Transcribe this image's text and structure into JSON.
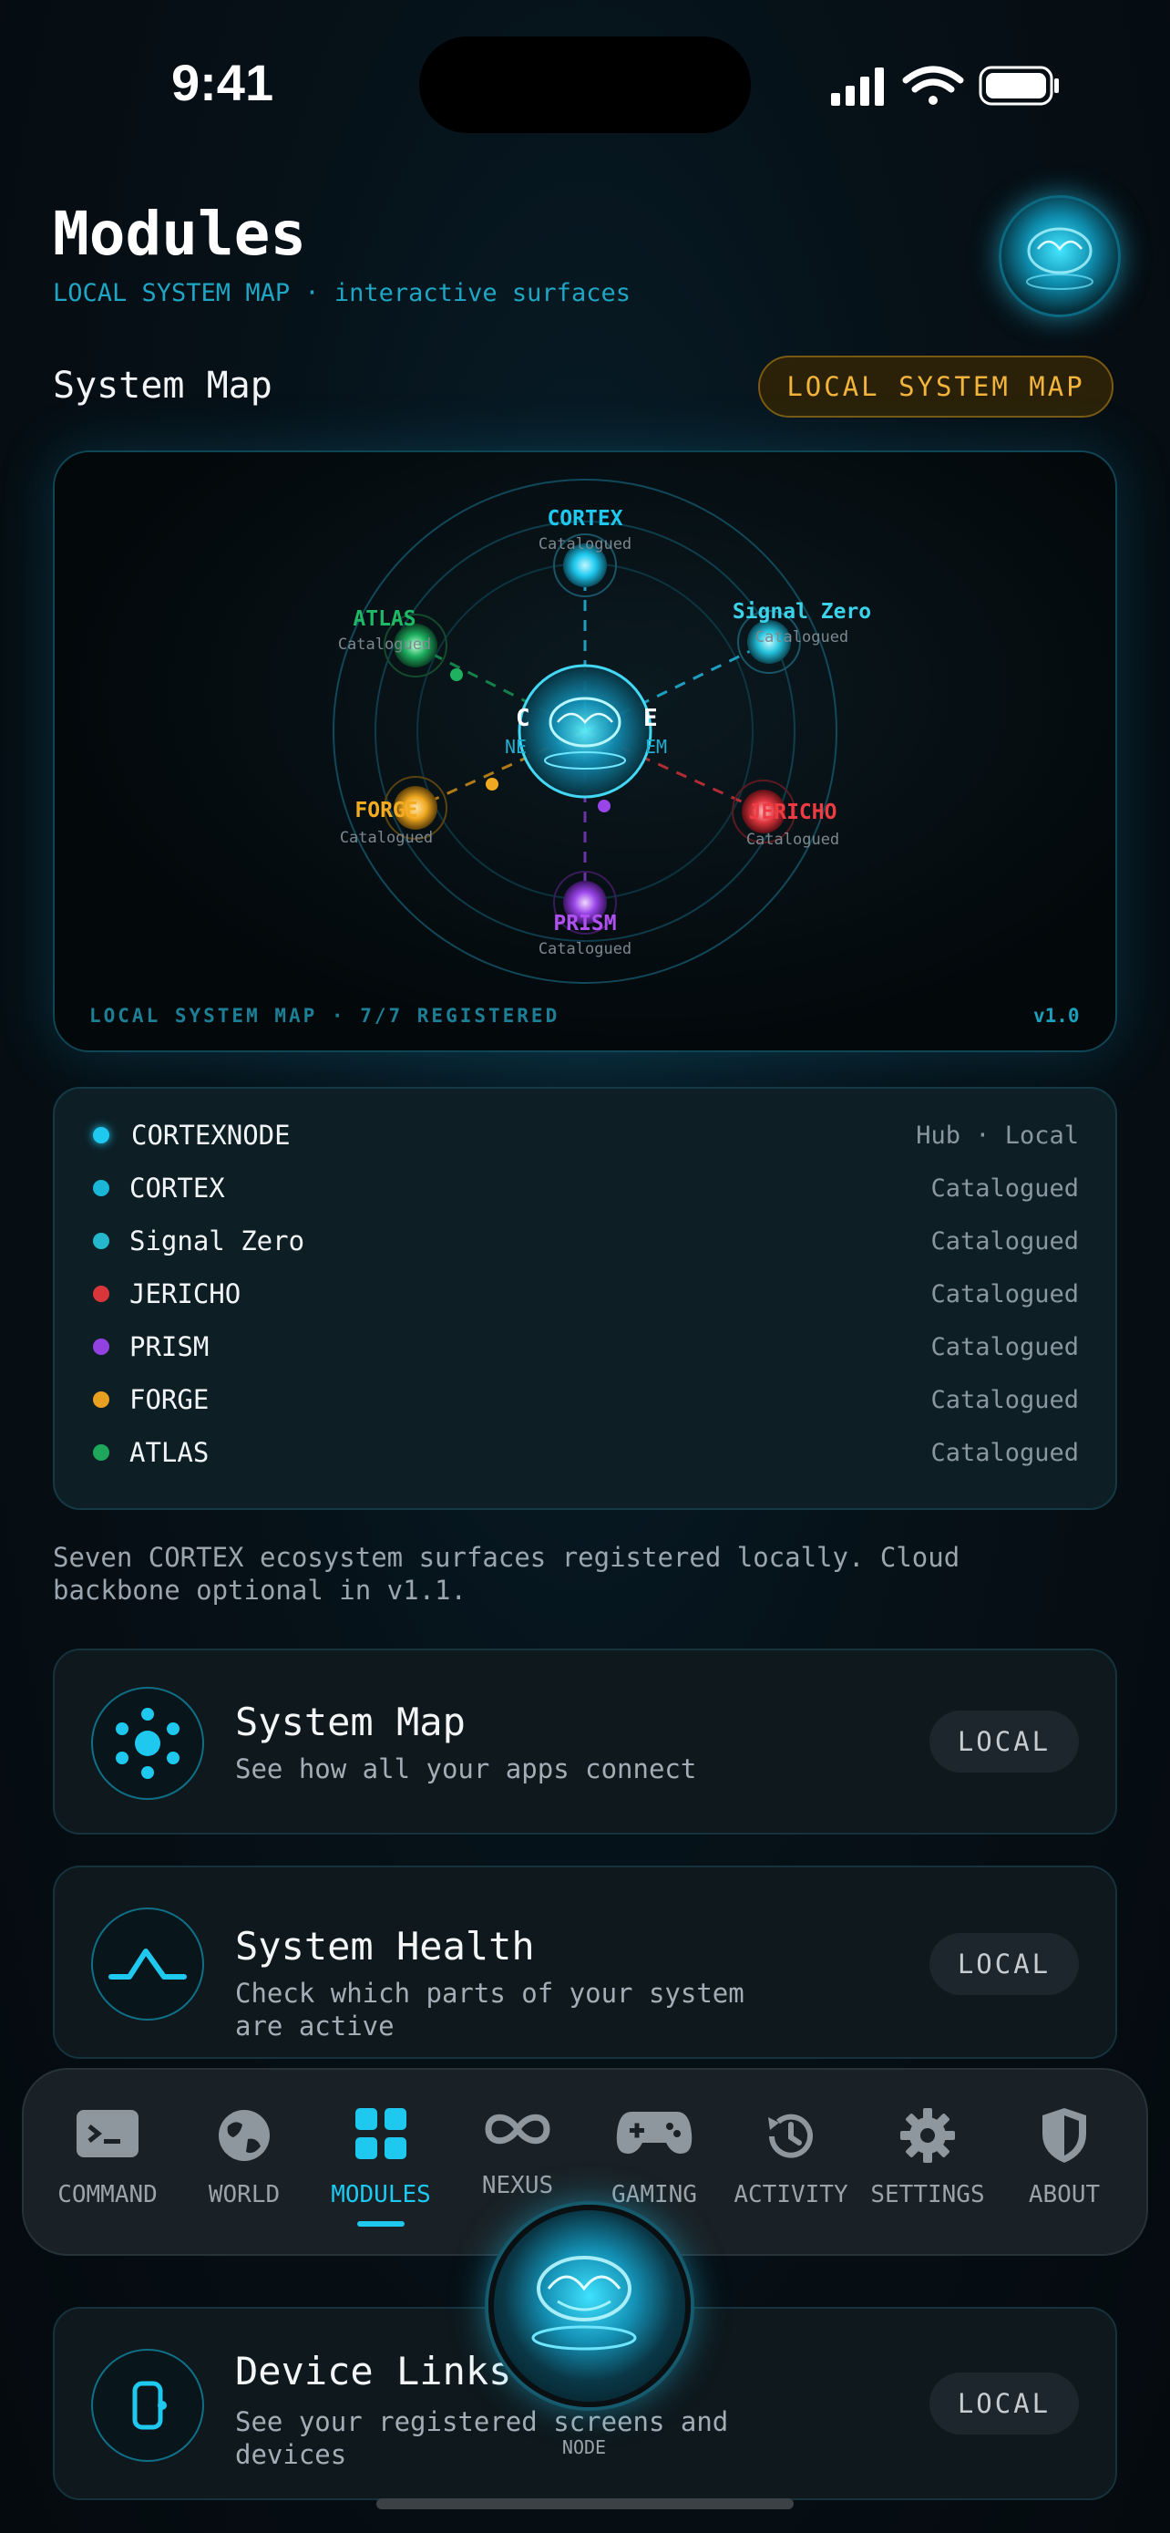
{
  "status_bar": {
    "time": "9:41"
  },
  "header": {
    "title": "Modules",
    "subtitle": "LOCAL SYSTEM MAP · interactive surfaces",
    "avatar_icon": "brain-hologram-icon"
  },
  "section": {
    "title": "System Map",
    "badge": "LOCAL SYSTEM MAP"
  },
  "map": {
    "hub": {
      "name_left": "C",
      "name_right": "E",
      "sub_left": "NE",
      "sub_right": "EM"
    },
    "nodes": [
      {
        "name": "CORTEX",
        "status": "Catalogued",
        "color": "#1ec8ee"
      },
      {
        "name": "Signal Zero",
        "status": "Catalogued",
        "color": "#25c2dc"
      },
      {
        "name": "JERICHO",
        "status": "Catalogued",
        "color": "#e0373f"
      },
      {
        "name": "PRISM",
        "status": "Catalogued",
        "color": "#9a45e8"
      },
      {
        "name": "FORGE",
        "status": "Catalogued",
        "color": "#f0a820"
      },
      {
        "name": "ATLAS",
        "status": "Catalogued",
        "color": "#1fb060"
      }
    ],
    "footer_left": "LOCAL SYSTEM MAP · 7/7 REGISTERED",
    "footer_right": "v1.0"
  },
  "legend": [
    {
      "name": "CORTEXNODE",
      "status": "Hub · Local",
      "color": "#1ec8ee"
    },
    {
      "name": "CORTEX",
      "status": "Catalogued",
      "color": "#19b6d6"
    },
    {
      "name": "Signal Zero",
      "status": "Catalogued",
      "color": "#25b8cc"
    },
    {
      "name": "JERICHO",
      "status": "Catalogued",
      "color": "#d9363c"
    },
    {
      "name": "PRISM",
      "status": "Catalogued",
      "color": "#9242e0"
    },
    {
      "name": "FORGE",
      "status": "Catalogued",
      "color": "#e8a020"
    },
    {
      "name": "ATLAS",
      "status": "Catalogued",
      "color": "#1ea65a"
    }
  ],
  "description": "Seven CORTEX ecosystem surfaces registered locally. Cloud backbone optional in v1.1.",
  "features": [
    {
      "title": "System Map",
      "subtitle": "See how all your apps connect",
      "badge": "LOCAL",
      "icon": "network-nodes-icon"
    },
    {
      "title": "System Health",
      "subtitle": "Check which parts of your system are active",
      "badge": "LOCAL",
      "icon": "health-wave-icon"
    },
    {
      "title": "Device Links",
      "subtitle": "See your registered screens and devices",
      "badge": "LOCAL",
      "icon": "device-link-icon"
    }
  ],
  "tabs": [
    {
      "label": "COMMAND",
      "icon": "terminal-icon"
    },
    {
      "label": "WORLD",
      "icon": "globe-icon"
    },
    {
      "label": "MODULES",
      "icon": "grid-icon",
      "active": true
    },
    {
      "label": "NEXUS",
      "icon": "infinity-icon"
    },
    {
      "label": "GAMING",
      "icon": "gamepad-icon"
    },
    {
      "label": "ACTIVITY",
      "icon": "history-icon"
    },
    {
      "label": "SETTINGS",
      "icon": "gear-icon"
    },
    {
      "label": "ABOUT",
      "icon": "shield-icon"
    }
  ],
  "node_button": {
    "label": "NODE",
    "icon": "brain-hologram-icon"
  },
  "colors": {
    "accent": "#1ec8ee",
    "warning": "#f3b43c"
  }
}
